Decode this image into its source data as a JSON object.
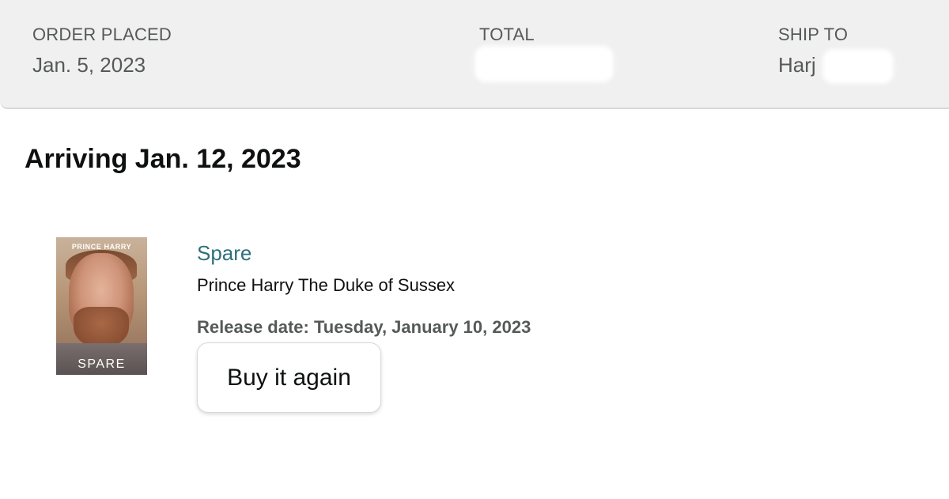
{
  "order": {
    "placed_label": "ORDER PLACED",
    "placed_value": "Jan. 5, 2023",
    "total_label": "TOTAL",
    "total_value": "",
    "ship_to_label": "SHIP TO",
    "ship_to_value": "Harj"
  },
  "shipment": {
    "arriving_text": "Arriving Jan. 12, 2023"
  },
  "item": {
    "cover": {
      "author_text": "PRINCE HARRY",
      "title_text": "SPARE"
    },
    "title": "Spare",
    "author": "Prince Harry The Duke of Sussex",
    "release_date": "Release date: Tuesday, January 10, 2023",
    "buy_again_label": "Buy it again"
  },
  "colors": {
    "header_bg": "#f0f0f0",
    "link": "#2f6f7a",
    "secondary_text": "#565959",
    "primary_text": "#0f1111"
  }
}
